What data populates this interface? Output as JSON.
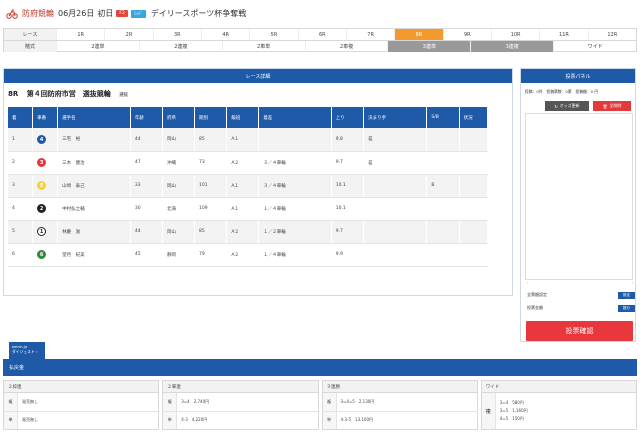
{
  "header": {
    "venue": "防府競輪",
    "date": "06月26日",
    "day": "初日",
    "grade_badge": "F2",
    "time_badge": "ﾐｯﾄﾞ",
    "race_name": "デイリースポーツ杯争奪戦",
    "colors": {
      "venue": "#c0392b"
    }
  },
  "race_tabs": {
    "race_label": "レース",
    "races": [
      "1R",
      "2R",
      "3R",
      "4R",
      "5R",
      "6R",
      "7R",
      "8R",
      "9R",
      "10R",
      "11R",
      "12R"
    ],
    "active_index": 7,
    "bet_label": "賭式",
    "bet_types": [
      "2連単",
      "2連複",
      "2車単",
      "2車複",
      "3連単",
      "3連複",
      "ワイド"
    ],
    "bet_dark_indices": [
      4,
      5
    ],
    "colors": {
      "active": "#f39a2c"
    }
  },
  "race_panel": {
    "header": "レース詳細",
    "race_no": "8R",
    "race_title": "第４回防府市営　選抜競輪",
    "race_sub": "選抜",
    "columns": [
      "着",
      "車番",
      "選手名",
      "年齢",
      "府県",
      "期別",
      "級班",
      "着差",
      "上り",
      "決まり手",
      "S/B",
      "状況"
    ],
    "rows": [
      {
        "pos": "1",
        "car": "4",
        "name": "三宅　裕",
        "age": "44",
        "pref": "岡山",
        "term": "85",
        "cls": "A１",
        "margin": "",
        "up": "9.8",
        "kimarite": "差",
        "sb": "",
        "status": ""
      },
      {
        "pos": "2",
        "car": "3",
        "name": "三木　健治",
        "age": "47",
        "pref": "沖縄",
        "term": "73",
        "cls": "A２",
        "margin": "３／４車輪",
        "up": "9.7",
        "kimarite": "差",
        "sb": "",
        "status": ""
      },
      {
        "pos": "3",
        "car": "5",
        "name": "山崎　泰己",
        "age": "33",
        "pref": "岡山",
        "term": "101",
        "cls": "A１",
        "margin": "３／４車輪",
        "up": "10.1",
        "kimarite": "",
        "sb": "B",
        "status": ""
      },
      {
        "pos": "4",
        "car": "2",
        "name": "中村弘之輔",
        "age": "30",
        "pref": "北海",
        "term": "109",
        "cls": "A１",
        "margin": "１／４車輪",
        "up": "10.1",
        "kimarite": "",
        "sb": "",
        "status": ""
      },
      {
        "pos": "5",
        "car": "1",
        "name": "林慶　滋",
        "age": "44",
        "pref": "岡山",
        "term": "85",
        "cls": "A２",
        "margin": "１／２車輪",
        "up": "9.7",
        "kimarite": "",
        "sb": "",
        "status": ""
      },
      {
        "pos": "6",
        "car": "6",
        "name": "望月　紀美",
        "age": "45",
        "pref": "静岡",
        "term": "79",
        "cls": "A２",
        "margin": "１／４車輪",
        "up": "9.9",
        "kimarite": "",
        "sb": "",
        "status": ""
      }
    ],
    "car_colors": {
      "1": {
        "bg": "#ffffff",
        "fg": "#222222",
        "border": "#222222"
      },
      "2": {
        "bg": "#222222",
        "fg": "#ffffff",
        "border": "#222222"
      },
      "3": {
        "bg": "#e23a3a",
        "fg": "#ffffff",
        "border": "#e23a3a"
      },
      "4": {
        "bg": "#1e5aa8",
        "fg": "#ffffff",
        "border": "#1e5aa8"
      },
      "5": {
        "bg": "#f2d33a",
        "fg": "#ffffff",
        "border": "#f2d33a"
      },
      "6": {
        "bg": "#2e8b3a",
        "fg": "#ffffff",
        "border": "#2e8b3a"
      }
    },
    "digest_line1": "keirin.jp",
    "digest_line2": "ダイジェスト"
  },
  "vote_panel": {
    "header": "投票パネル",
    "status": "投稿：0件　投稿票数：0票　投稿額：0 円",
    "odds_button": "オッズ更新",
    "delete_button": "全削除",
    "scroll_left": "‹",
    "scroll_right": "›",
    "bulk_label": "全票額設定",
    "bulk_button": "設定",
    "amount_label": "投票金額",
    "amount_button": "数分",
    "confirm_button": "投票確認"
  },
  "payout": {
    "header": "払戻金",
    "columns": [
      {
        "title": "２枠連",
        "rows": [
          {
            "key": "複",
            "val": "発売無し"
          },
          {
            "key": "単",
            "val": "発売無し"
          }
        ]
      },
      {
        "title": "２車連",
        "rows": [
          {
            "key": "複",
            "val": "3=4　2,740円"
          },
          {
            "key": "単",
            "val": "4-3　4,220円"
          }
        ]
      },
      {
        "title": "３連勝",
        "rows": [
          {
            "key": "複",
            "val": "3=4=5　2,130円"
          },
          {
            "key": "単",
            "val": "4-3-5　13,100円"
          }
        ]
      }
    ],
    "wide": {
      "title": "ワイド",
      "key": "複",
      "lines": [
        "3=4　580円",
        "3=5　1,160円",
        "4=5　150円"
      ]
    }
  }
}
